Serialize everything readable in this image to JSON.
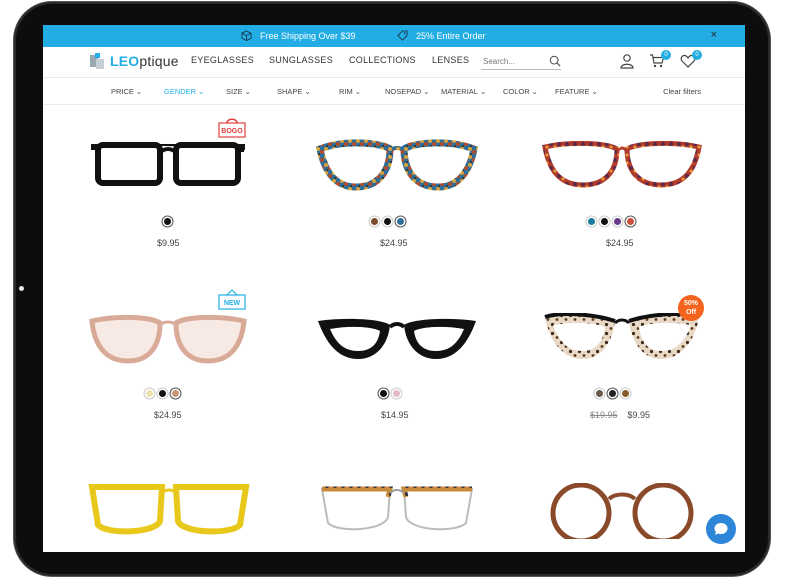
{
  "promo": {
    "shipping": "Free Shipping Over $39",
    "discount": "25% Entire Order",
    "close": "×"
  },
  "header": {
    "logo_prefix": "LEO",
    "logo_suffix": "ptique",
    "nav": [
      "EYEGLASSES",
      "SUNGLASSES",
      "COLLECTIONS",
      "LENSES"
    ],
    "search_placeholder": "Search...",
    "cart_count": "0",
    "wishlist_count": "0"
  },
  "filters": {
    "items": [
      "PRICE",
      "GENDER",
      "SIZE",
      "SHAPE",
      "RIM",
      "NOSEPAD",
      "MATERIAL",
      "COLOR",
      "FEATURE"
    ],
    "active": "GENDER",
    "clear": "Clear filters"
  },
  "products": [
    {
      "price": "$9.95",
      "badge": "BOGO",
      "colors": [
        "#111111"
      ]
    },
    {
      "price": "$24.95",
      "colors": [
        "#7a4a2a",
        "#111111",
        "#2f6e99"
      ]
    },
    {
      "price": "$24.95",
      "colors": [
        "#1a7a9c",
        "#111111",
        "#6a3a8c",
        "#c8503a"
      ]
    },
    {
      "price": "$24.95",
      "badge": "NEW",
      "colors": [
        "#efe3b0",
        "#111111",
        "#c9967a"
      ]
    },
    {
      "price": "$14.95",
      "colors": [
        "#111111",
        "#e2b8c6"
      ]
    },
    {
      "price": "$9.95",
      "old_price": "$19.95",
      "badge": "50% Off",
      "colors": [
        "#6a5a4a",
        "#222222",
        "#8a5a2a"
      ]
    },
    {
      "price": "",
      "colors": []
    },
    {
      "price": "",
      "colors": []
    },
    {
      "price": "",
      "colors": []
    }
  ],
  "colors": {
    "accent": "#22aee4",
    "sale": "#f4641d",
    "bogo": "#e23b3b",
    "chat": "#2e86d9"
  }
}
